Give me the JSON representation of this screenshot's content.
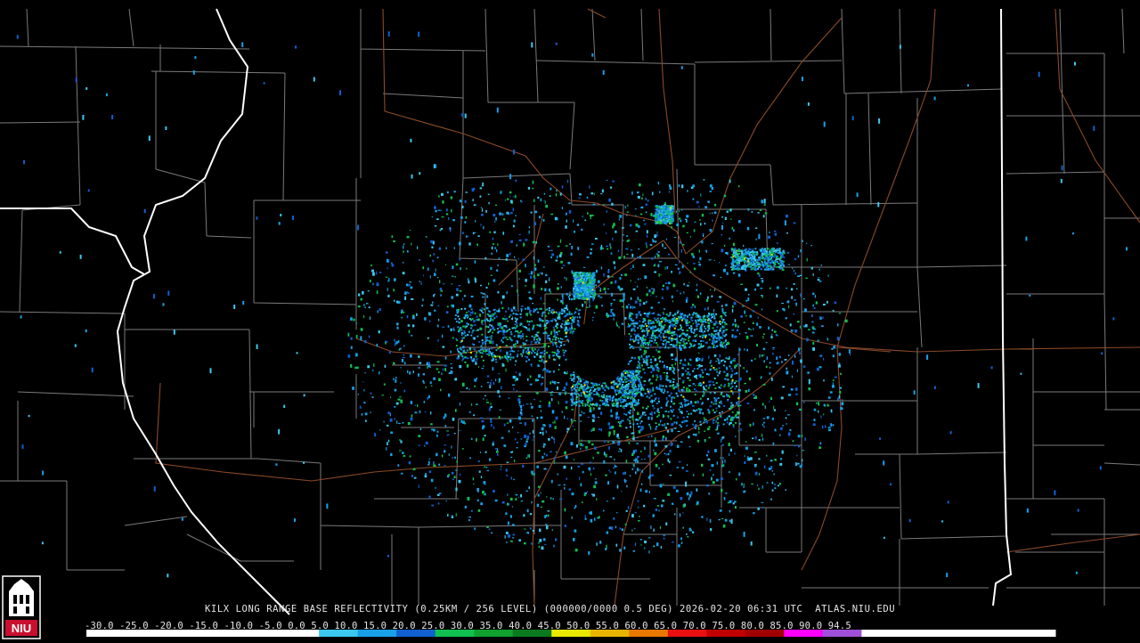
{
  "product": {
    "title": "KILX LONG RANGE BASE REFLECTIVITY (0.25KM / 256 LEVEL) (000000/0000 0.5 DEG) 2026-02-20 06:31 UTC  ATLAS.NIU.EDU"
  },
  "colorbar": {
    "ticks": [
      "-30.0",
      "-25.0",
      "-20.0",
      "-15.0",
      "-10.0",
      "-5.0",
      "0.0",
      "5.0",
      "10.0",
      "15.0",
      "20.0",
      "25.0",
      "30.0",
      "35.0",
      "40.0",
      "45.0",
      "50.0",
      "55.0",
      "60.0",
      "65.0",
      "70.0",
      "75.0",
      "80.0",
      "85.0",
      "90.0",
      "94.5"
    ],
    "segments": [
      "#ffffff",
      "#ffffff",
      "#ffffff",
      "#ffffff",
      "#ffffff",
      "#ffffff",
      "#3cc8f0",
      "#1aa0e8",
      "#1060d0",
      "#10c050",
      "#10a030",
      "#0a7a20",
      "#e8e800",
      "#e8b400",
      "#e87800",
      "#e81010",
      "#c00000",
      "#a00000",
      "#ff00ff",
      "#a050d8",
      "#ffffff",
      "#ffffff",
      "#ffffff",
      "#ffffff",
      "#ffffff"
    ]
  },
  "logo": {
    "text": "NIU"
  },
  "colors": {
    "background": "#000000",
    "county_lines": "#7a7a7a",
    "state_lines": "#ffffff",
    "highways": "#8b4a28"
  }
}
